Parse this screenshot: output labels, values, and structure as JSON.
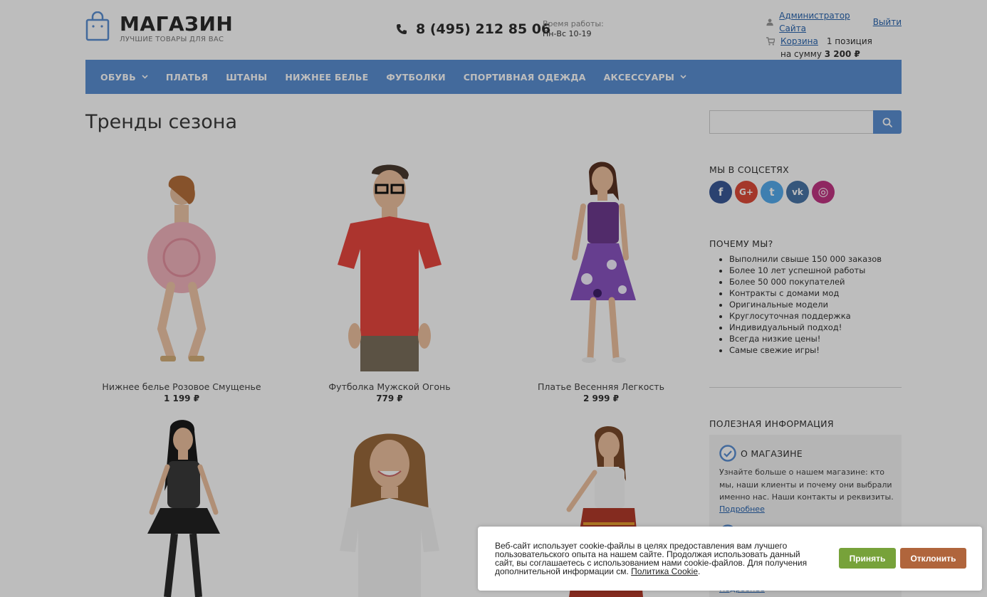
{
  "header": {
    "logo_title": "МАГАЗИН",
    "logo_subtitle": "ЛУЧШИЕ ТОВАРЫ ДЛЯ ВАС",
    "phone": "8 (495) 212 85 06",
    "work_label": "Время работы:",
    "work_hours": "Пн-Вс 10-19",
    "user_link": "Администратор Сайта",
    "logout_link": "Выйти",
    "cart_link": "Корзина",
    "cart_count": "1 позиция",
    "cart_sum_label": "на сумму",
    "cart_sum_value": "3 200 ₽"
  },
  "nav": {
    "items": [
      {
        "label": "Обувь",
        "has_dropdown": true
      },
      {
        "label": "Платья",
        "has_dropdown": false
      },
      {
        "label": "Штаны",
        "has_dropdown": false
      },
      {
        "label": "Нижнее белье",
        "has_dropdown": false
      },
      {
        "label": "Футболки",
        "has_dropdown": false
      },
      {
        "label": "Спортивная одежда",
        "has_dropdown": false
      },
      {
        "label": "Аксессуары",
        "has_dropdown": true
      }
    ]
  },
  "main": {
    "title": "Тренды сезона",
    "products": [
      {
        "name": "Нижнее белье Розовое Смущенье",
        "price": "1 199 ₽"
      },
      {
        "name": "Футболка Мужской Огонь",
        "price": "779 ₽"
      },
      {
        "name": "Платье Весенняя Легкость",
        "price": "2 999 ₽"
      }
    ]
  },
  "sidebar": {
    "search_placeholder": "",
    "social_title": "Мы в соцсетях",
    "social": [
      {
        "name": "facebook-icon",
        "glyph": "f",
        "color": "#3b5998"
      },
      {
        "name": "google-plus-icon",
        "glyph": "G+",
        "color": "#dd4b39"
      },
      {
        "name": "twitter-icon",
        "glyph": "t",
        "color": "#55acee"
      },
      {
        "name": "vk-icon",
        "glyph": "vk",
        "color": "#4a76a8"
      },
      {
        "name": "instagram-icon",
        "glyph": "◎",
        "color": "#c13584"
      }
    ],
    "why_title": "Почему мы?",
    "why_items": [
      "Выполнили свыше 150 000 заказов",
      "Более 10 лет успешной работы",
      "Более 50 000 покупателей",
      "Контракты с домами мод",
      "Оригинальные модели",
      "Круглосуточная поддержка",
      "Индивидуальный подход!",
      "Всегда низкие цены!",
      "Самые свежие игры!"
    ],
    "info_title": "Полезная информация",
    "about_title": "О магазине",
    "about_text": "Узнайте больше о нашем магазине: кто мы, наши клиенты и почему они выбрали именно нас. Наши контакты и реквизиты.",
    "about_more": "Подробнее",
    "more2": "Подробнее"
  },
  "cookie": {
    "text": "Веб-сайт использует cookie-файлы в целях предоставления вам лучшего пользовательского опыта на нашем сайте. Продолжая использовать данный сайт, вы соглашаетесь с использованием нами cookie-файлов. Для получения дополнительной информации см.",
    "policy_link": "Политика Cookie",
    "accept": "Принять",
    "decline": "Отклонить"
  },
  "colors": {
    "accent": "#5b8fd3",
    "accept": "#77a23a",
    "decline": "#b0653c"
  }
}
